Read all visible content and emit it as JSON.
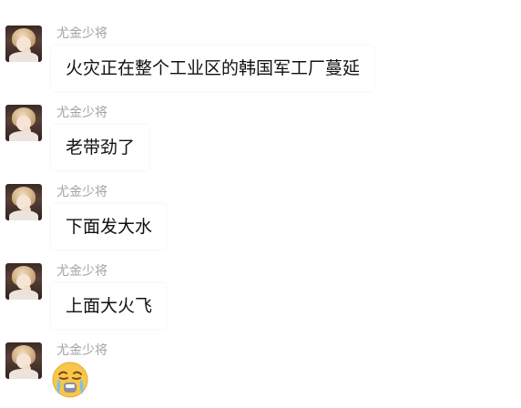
{
  "messages": [
    {
      "sender": "尤金少将",
      "text": "火灾正在整个工业区的韩国军工厂蔓延"
    },
    {
      "sender": "尤金少将",
      "text": "老带劲了"
    },
    {
      "sender": "尤金少将",
      "text": "下面发大水"
    },
    {
      "sender": "尤金少将",
      "text": "上面大火飞"
    },
    {
      "sender": "尤金少将",
      "sticker": "crying-face-emoji"
    }
  ]
}
